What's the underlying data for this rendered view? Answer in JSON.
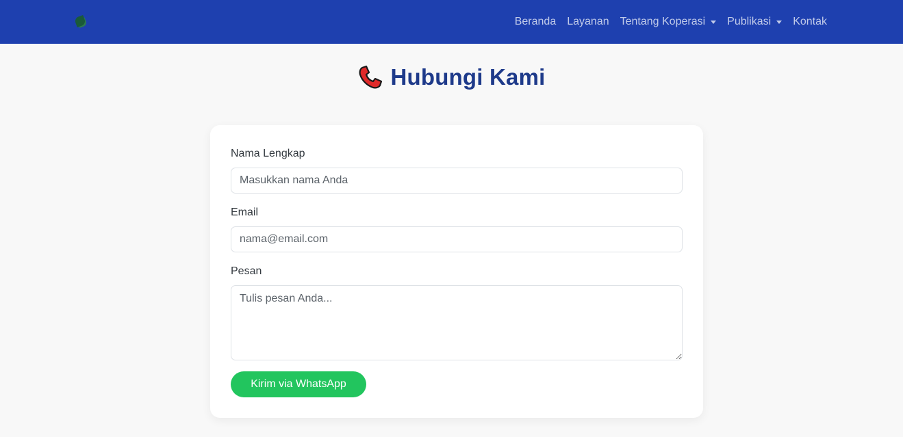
{
  "navbar": {
    "items": [
      {
        "label": "Beranda"
      },
      {
        "label": "Layanan"
      },
      {
        "label": "Tentang Koperasi",
        "dropdown": true
      },
      {
        "label": "Publikasi",
        "dropdown": true
      },
      {
        "label": "Kontak"
      }
    ],
    "background": "#1e40af"
  },
  "page": {
    "title": "Hubungi Kami",
    "title_icon": "telephone-receiver-icon"
  },
  "form": {
    "name_label": "Nama Lengkap",
    "name_placeholder": "Masukkan nama Anda",
    "email_label": "Email",
    "email_placeholder": "nama@email.com",
    "message_label": "Pesan",
    "message_placeholder": "Tulis pesan Anda...",
    "submit_label": "Kirim via WhatsApp",
    "submit_color": "#22c55e"
  }
}
